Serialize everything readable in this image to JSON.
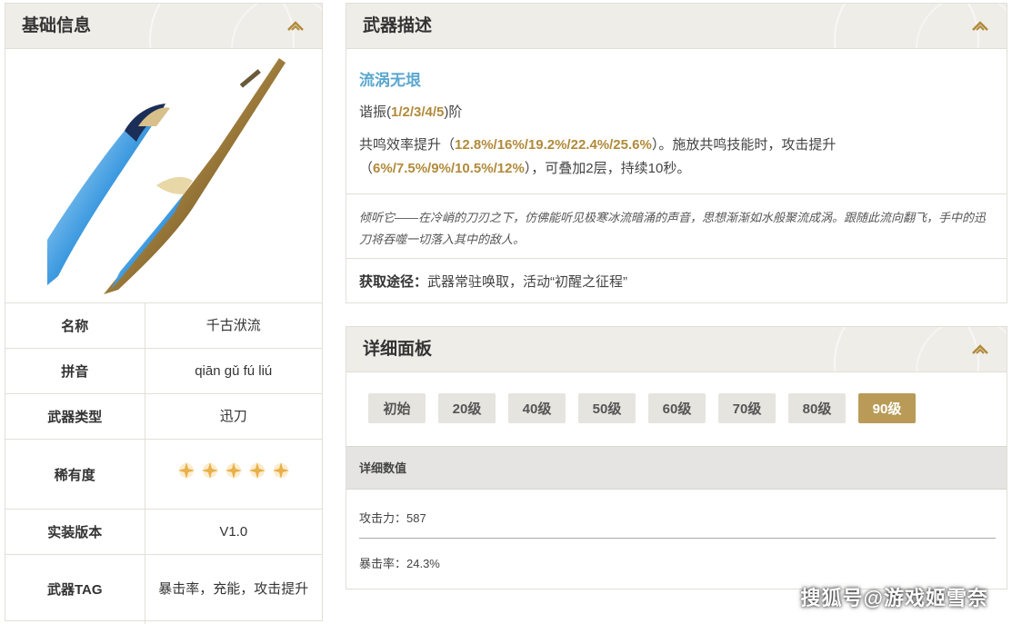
{
  "basic": {
    "title": "基础信息",
    "rows": [
      {
        "key": "名称",
        "value": "千古洑流"
      },
      {
        "key": "拼音",
        "value": "qiān gǔ fú liú"
      },
      {
        "key": "武器类型",
        "value": "迅刀"
      },
      {
        "key": "稀有度",
        "stars": 5
      },
      {
        "key": "实装版本",
        "value": "V1.0"
      },
      {
        "key": "武器TAG",
        "value": "暴击率，充能，攻击提升"
      }
    ]
  },
  "description": {
    "title": "武器描述",
    "skill_name": "流涡无垠",
    "resonance_prefix": "谐振(",
    "resonance_levels": "1/2/3/4/5",
    "resonance_suffix": ")阶",
    "effect_1a": "共鸣效率提升（",
    "effect_1b": "12.8%/16%/19.2%/22.4%/25.6%",
    "effect_1c": "）。施放共鸣技能时，攻击提升",
    "effect_2a": "（",
    "effect_2b": "6%/7.5%/9%/10.5%/12%",
    "effect_2c": "），可叠加2层，持续10秒。",
    "flavor": "倾听它——在冷峭的刀刃之下，仿佛能听见极寒冰流暗涌的声音，思想渐渐如水般聚流成涡。跟随此流向翻飞，手中的迅刀将吞噬一切落入其中的敌人。",
    "acquire_label": "获取途径：",
    "acquire_value": "武器常驻唤取，活动“初醒之征程”"
  },
  "detail": {
    "title": "详细面板",
    "levels": [
      "初始",
      "20级",
      "40级",
      "50级",
      "60级",
      "70级",
      "80级",
      "90级"
    ],
    "active_level": "90级",
    "values_header": "详细数值",
    "attack": "攻击力：587",
    "crit": "暴击率：24.3%"
  },
  "watermark": "搜狐号@游戏姬雪奈",
  "colors": {
    "accent_gold": "#b18a3a",
    "active_tab": "#b99b57",
    "skill_blue": "#5aa7cf",
    "header_bg": "#efede8"
  },
  "icons": {
    "collapse": "chevron-up-icon",
    "rarity": "star-icon",
    "weapon": "weapon-image"
  }
}
